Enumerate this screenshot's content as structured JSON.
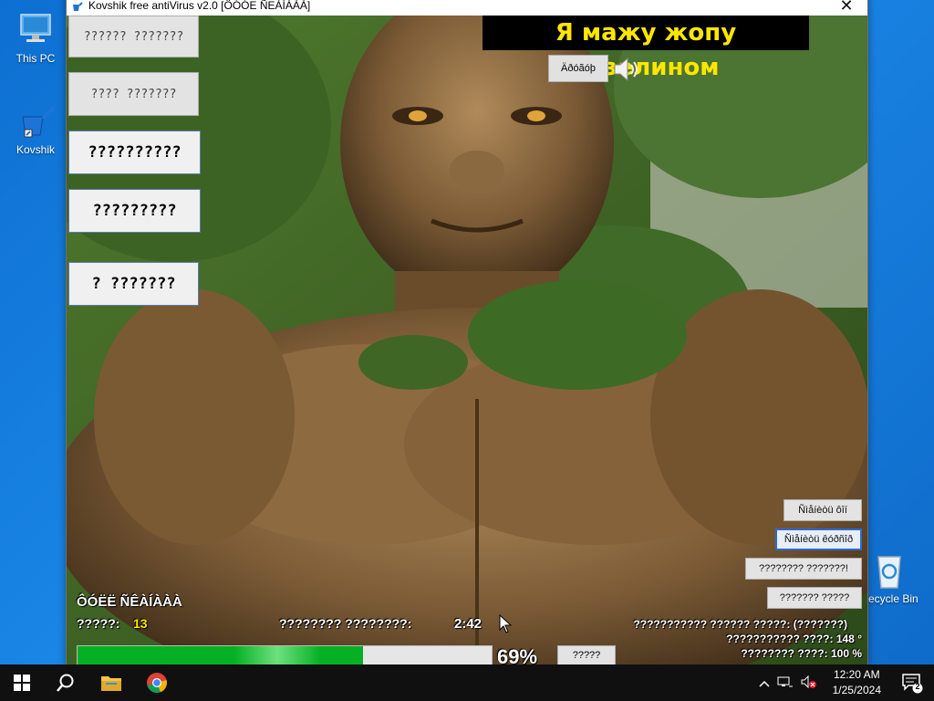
{
  "desktop": {
    "icons": [
      {
        "label": "This PC"
      },
      {
        "label": "Kovshik"
      },
      {
        "label": "Recycle Bin"
      }
    ]
  },
  "window": {
    "title": "Kovshik free antiVirus v2.0 [ÖÓÓE ÑEÀÍÀÀÀ]",
    "close_glyph": "✕"
  },
  "sidebar": {
    "buttons": [
      {
        "label": "?????? ???????"
      },
      {
        "label": "???? ???????"
      },
      {
        "label": "??????????"
      },
      {
        "label": "?????????"
      },
      {
        "label": "? ???????"
      }
    ]
  },
  "banner": {
    "text": "Я мажу жопу вазелином"
  },
  "audio": {
    "play_label": "Äðóãóþ"
  },
  "right_buttons": [
    {
      "label": "Ñìåíèòü ôîí"
    },
    {
      "label": "Ñìåíèòü êóðñîð"
    },
    {
      "label": "???????? ???????!"
    },
    {
      "label": "??????? ?????"
    }
  ],
  "scan": {
    "status_title": "ÔÓËË ÑÊÀÍÀÀÀ",
    "threats_label": "?????:",
    "threats_value": "13",
    "time_label": "???????? ????????:",
    "time_value": "2:42",
    "progress_percent": 69,
    "percent_text": "69%",
    "small_button": "?????"
  },
  "stats": [
    "??????????? ?????? ?????: (???????)",
    "??????????? ????:   148 °",
    "???????? ????:  100 %"
  ],
  "taskbar": {
    "time": "12:20 AM",
    "date": "1/25/2024",
    "notification_count": "2"
  }
}
